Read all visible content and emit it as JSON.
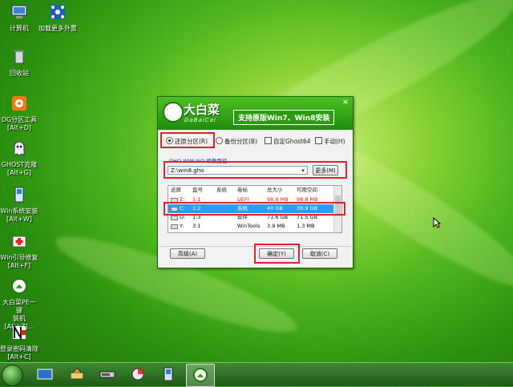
{
  "desktop": {
    "icons": [
      {
        "name": "computer",
        "label": "计算机"
      },
      {
        "name": "load-devices",
        "label": "加载更多外置"
      },
      {
        "name": "recycle-bin",
        "label": "回收站"
      },
      {
        "name": "dg-partition",
        "label": "DG分区工具\n[Alt+D]"
      },
      {
        "name": "ghost",
        "label": "GHOST克隆\n[Alt+G]"
      },
      {
        "name": "win-install",
        "label": "Win系统安装\n[Alt+W]"
      },
      {
        "name": "boot-repair",
        "label": "Win引导修复\n[Alt+F]"
      },
      {
        "name": "dabaicai-pe",
        "label": "大白菜PE一键\n装机[Alt+Z]..."
      },
      {
        "name": "password-clear",
        "label": "登录密码清除\n[Alt+C]"
      }
    ]
  },
  "dialog": {
    "brand": "大白菜",
    "brand_sub": "DaBaiCai",
    "slogan": "支持原版Win7、Win8安装",
    "close": "×",
    "options": {
      "restore": "还原分区(R)",
      "backup": "备份分区(B)",
      "custom_ghost": "自定Ghost64",
      "manual": "手动(H)"
    },
    "path_label": "GHO WIM ISO 映像路径",
    "path_value": "Z:\\win8.gho",
    "more_button": "更多(M)",
    "table": {
      "headers": [
        "还原",
        "盘号",
        "系统",
        "卷标",
        "总大小",
        "可用空间"
      ],
      "rows": [
        {
          "restore": "Z:",
          "disk": "1:1",
          "system": "",
          "label": "UEFI",
          "total": "98.8 MB",
          "free": "98.8 MB"
        },
        {
          "restore": "C:",
          "disk": "1:2",
          "system": "",
          "label": "系统",
          "total": "40 GB",
          "free": "39.9 GB"
        },
        {
          "restore": "D:",
          "disk": "1:3",
          "system": "",
          "label": "软件",
          "total": "71.6 GB",
          "free": "71.5 GB"
        },
        {
          "restore": "Y:",
          "disk": "3:1",
          "system": "",
          "label": "WinTools",
          "total": "3.9 MB",
          "free": "1.3 MB"
        }
      ]
    },
    "advanced_button": "高级(A)",
    "ok_button": "确定(Y)",
    "cancel_button": "取消(C)"
  },
  "colors": {
    "highlight": "#e0202a",
    "selection": "#3399ff",
    "desktop": "#2a8f0e"
  }
}
